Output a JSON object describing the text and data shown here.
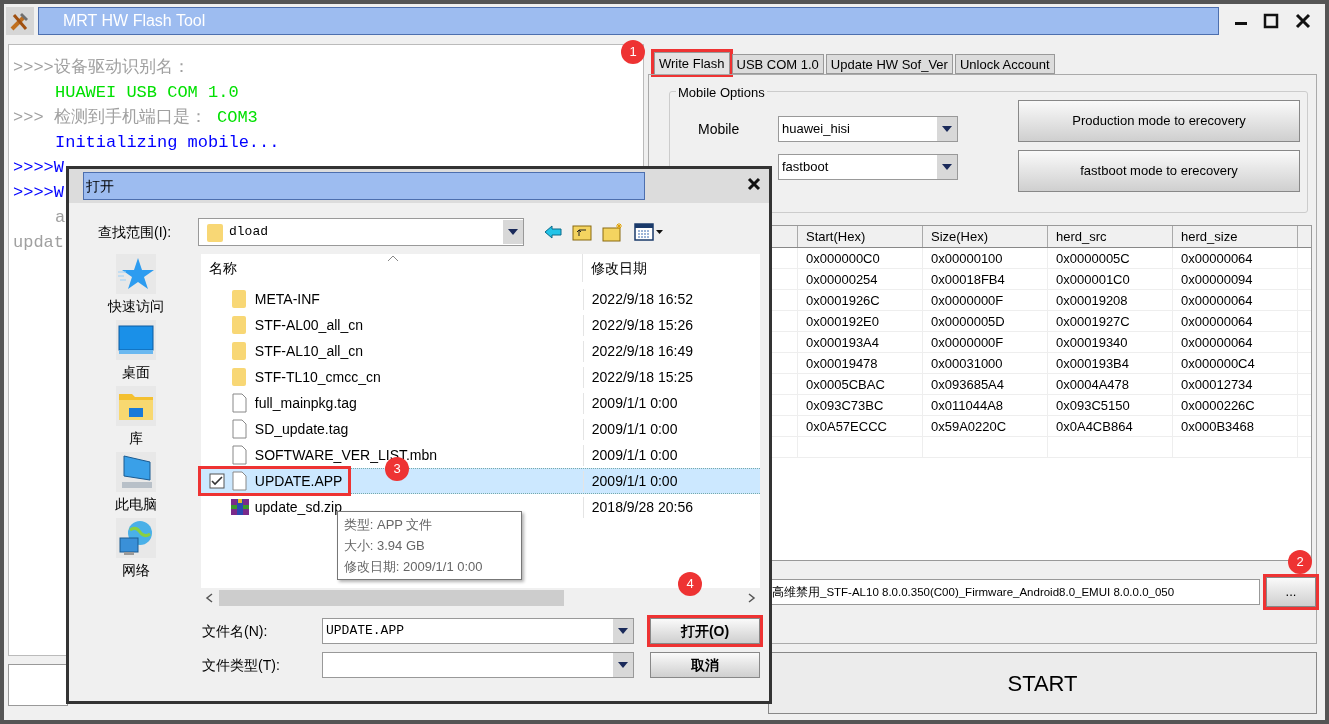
{
  "window": {
    "title": "MRT HW Flash Tool"
  },
  "log": [
    {
      "indented": false,
      "segments": [
        {
          "text": ">>>>设备驱动识别名：",
          "color": "#a0a0a0"
        }
      ]
    },
    {
      "indented": true,
      "segments": [
        {
          "text": "HUAWEI USB COM 1.0",
          "color": "#00e000"
        }
      ]
    },
    {
      "indented": false,
      "segments": [
        {
          "text": ">>> 检测到手机端口是：",
          "color": "#a0a0a0"
        },
        {
          "text": " COM3",
          "color": "#00e000"
        }
      ]
    },
    {
      "indented": true,
      "segments": [
        {
          "text": "Initializing mobile...",
          "color": "#0000ff"
        }
      ]
    },
    {
      "indented": false,
      "segments": [
        {
          "text": ">>>>W",
          "color": "#0000ff"
        }
      ]
    },
    {
      "indented": false,
      "segments": [
        {
          "text": ">>>>W",
          "color": "#0000ff"
        }
      ]
    },
    {
      "indented": true,
      "segments": [
        {
          "text": "a",
          "color": "#a0a0a0"
        }
      ]
    },
    {
      "indented": false,
      "segments": [
        {
          "text": "updat",
          "color": "#a0a0a0"
        }
      ]
    }
  ],
  "tabs": [
    {
      "label": "Write Flash",
      "selected": true,
      "annotation": "1"
    },
    {
      "label": "USB COM 1.0",
      "selected": false
    },
    {
      "label": "Update HW Sof_Ver",
      "selected": false
    },
    {
      "label": "Unlock Account",
      "selected": false
    }
  ],
  "mobile_options": {
    "title": "Mobile Options",
    "mobile_label": "Mobile",
    "mobile_value": "huawei_hisi",
    "mode_value": "fastboot",
    "buttons": [
      "Production mode to erecovery",
      "fastboot mode to erecovery"
    ]
  },
  "table": {
    "columns": [
      "Start(Hex)",
      "Size(Hex)",
      "herd_src",
      "herd_size"
    ],
    "rows": [
      [
        "0x000000C0",
        "0x00000100",
        "0x0000005C",
        "0x00000064"
      ],
      [
        "0x00000254",
        "0x00018FB4",
        "0x000001C0",
        "0x00000094"
      ],
      [
        "0x0001926C",
        "0x0000000F",
        "0x00019208",
        "0x00000064"
      ],
      [
        "0x000192E0",
        "0x0000005D",
        "0x0001927C",
        "0x00000064"
      ],
      [
        "0x000193A4",
        "0x0000000F",
        "0x00019340",
        "0x00000064"
      ],
      [
        "0x00019478",
        "0x00031000",
        "0x000193B4",
        "0x000000C4"
      ],
      [
        "0x0005CBAC",
        "0x093685A4",
        "0x0004A478",
        "0x00012734"
      ],
      [
        "0x093C73BC",
        "0x011044A8",
        "0x093C5150",
        "0x0000226C"
      ],
      [
        "0x0A57ECCC",
        "0x59A0220C",
        "0x0A4CB864",
        "0x000B3468"
      ]
    ]
  },
  "file_path": "高维禁用_STF-AL10 8.0.0.350(C00)_Firmware_Android8.0_EMUI 8.0.0.0_050",
  "browse_button": {
    "label": "...",
    "annotation": "2"
  },
  "start_button": "START",
  "dialog": {
    "title": "打开",
    "look_in_label": "查找范围(I):",
    "look_in_value": "dload",
    "places": [
      {
        "label": "快速访问",
        "kind": "star"
      },
      {
        "label": "桌面",
        "kind": "desktop"
      },
      {
        "label": "库",
        "kind": "library"
      },
      {
        "label": "此电脑",
        "kind": "computer"
      },
      {
        "label": "网络",
        "kind": "network"
      }
    ],
    "columns": [
      "名称",
      "修改日期"
    ],
    "files": [
      {
        "name": "META-INF",
        "date": "2022/9/18 16:52",
        "kind": "folder",
        "selected": false
      },
      {
        "name": "STF-AL00_all_cn",
        "date": "2022/9/18 15:26",
        "kind": "folder",
        "selected": false
      },
      {
        "name": "STF-AL10_all_cn",
        "date": "2022/9/18 16:49",
        "kind": "folder",
        "selected": false
      },
      {
        "name": "STF-TL10_cmcc_cn",
        "date": "2022/9/18 15:25",
        "kind": "folder",
        "selected": false
      },
      {
        "name": "full_mainpkg.tag",
        "date": "2009/1/1 0:00",
        "kind": "file",
        "selected": false
      },
      {
        "name": "SD_update.tag",
        "date": "2009/1/1 0:00",
        "kind": "file",
        "selected": false
      },
      {
        "name": "SOFTWARE_VER_LIST.mbn",
        "date": "2009/1/1 0:00",
        "kind": "file",
        "selected": false
      },
      {
        "name": "UPDATE.APP",
        "date": "2009/1/1 0:00",
        "kind": "file",
        "selected": true,
        "checked": true,
        "annotation": "3"
      },
      {
        "name": "update_sd.zip",
        "date": "2018/9/28 20:56",
        "kind": "archive",
        "selected": false
      }
    ],
    "tooltip": [
      "类型: APP 文件",
      "大小: 3.94 GB",
      "修改日期: 2009/1/1 0:00"
    ],
    "filename_label": "文件名(N):",
    "filename_value": "UPDATE.APP",
    "filetype_label": "文件类型(T):",
    "open_button": {
      "label": "打开(O)",
      "annotation": "4"
    },
    "cancel_button": "取消"
  }
}
